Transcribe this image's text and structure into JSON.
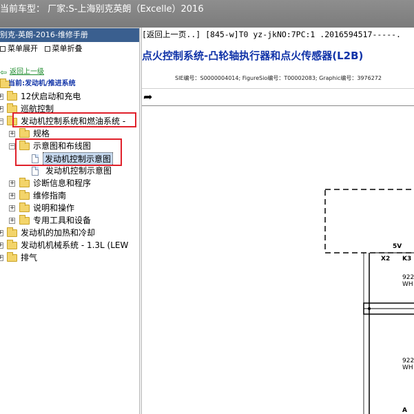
{
  "header": {
    "title": "当前车型： 厂家:S-上海别克英朗（Excelle）2016"
  },
  "left": {
    "manual_title": "别克-英朗-2016-维修手册",
    "expand_all": "菜单展开",
    "collapse_all": "菜单折叠",
    "back_link": "返回上一级",
    "current_label": "当前:发动机/推进系统"
  },
  "tree": {
    "items": [
      {
        "label": "12伏启动和充电"
      },
      {
        "label": "巡航控制"
      },
      {
        "label": "发动机控制系统和燃油系统 -"
      },
      {
        "label": "规格"
      },
      {
        "label": "示意图和布线图"
      },
      {
        "label": "发动机控制示意图"
      },
      {
        "label": "发动机控制示意图"
      },
      {
        "label": "诊断信息和程序"
      },
      {
        "label": "维修指南"
      },
      {
        "label": "说明和操作"
      },
      {
        "label": "专用工具和设备"
      },
      {
        "label": "发动机的加热和冷却"
      },
      {
        "label": "发动机机械系统 - 1.3L (LEW"
      },
      {
        "label": "排气"
      }
    ]
  },
  "content": {
    "breadcrumb": "[返回上一页..] [845-w]T0 yz-jkNO:7PC:1 .2016594517-----.",
    "title": "点火控制系统-凸轮轴执行器和点火传感器(L2B)",
    "ids": "SIE编号：S0000004014;  FigureSio编号：T00002083;  Graphic编号：3976272"
  },
  "diagram": {
    "labels": {
      "v5": "5V",
      "x2": "X2",
      "k3": "K3",
      "w1a": "922",
      "w1b": "WH",
      "w2a": "922",
      "w2b": "WH",
      "a": "A"
    }
  }
}
